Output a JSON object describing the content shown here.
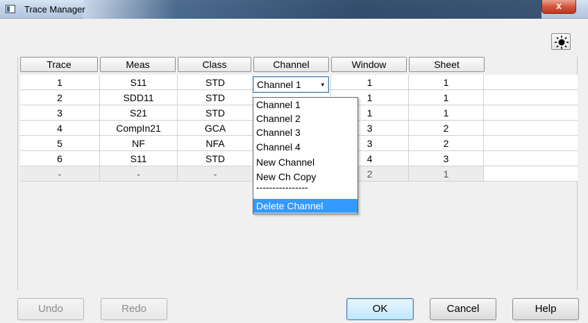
{
  "window": {
    "title": "Trace Manager",
    "close_glyph": "x"
  },
  "brightness_button": {
    "icon": "sun-icon"
  },
  "columns": [
    "Trace",
    "Meas",
    "Class",
    "Channel",
    "Window",
    "Sheet"
  ],
  "rows": [
    {
      "trace": "1",
      "meas": "S11",
      "class": "STD",
      "channel": "Channel 1",
      "window": "1",
      "sheet": "1"
    },
    {
      "trace": "2",
      "meas": "SDD11",
      "class": "STD",
      "channel": "",
      "window": "1",
      "sheet": "1"
    },
    {
      "trace": "3",
      "meas": "S21",
      "class": "STD",
      "channel": "",
      "window": "1",
      "sheet": "1"
    },
    {
      "trace": "4",
      "meas": "CompIn21",
      "class": "GCA",
      "channel": "",
      "window": "3",
      "sheet": "2"
    },
    {
      "trace": "5",
      "meas": "NF",
      "class": "NFA",
      "channel": "",
      "window": "3",
      "sheet": "2"
    },
    {
      "trace": "6",
      "meas": "S11",
      "class": "STD",
      "channel": "",
      "window": "4",
      "sheet": "3"
    },
    {
      "trace": "-",
      "meas": "-",
      "class": "-",
      "channel": "",
      "window": "2",
      "sheet": "1"
    }
  ],
  "channel_combo": {
    "value": "Channel 1",
    "arrow": "▾"
  },
  "channel_dropdown": {
    "options": [
      "Channel 1",
      "Channel 2",
      "Channel 3",
      "Channel 4",
      "New Channel",
      "New Ch Copy",
      "----------------",
      "Delete Channel"
    ],
    "selected_index": 7
  },
  "buttons": {
    "undo": "Undo",
    "redo": "Redo",
    "ok": "OK",
    "cancel": "Cancel",
    "help": "Help"
  }
}
